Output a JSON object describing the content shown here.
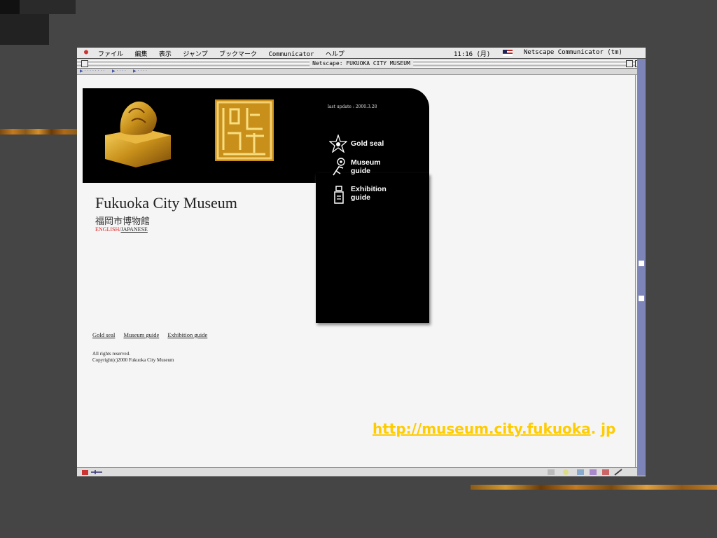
{
  "menubar": {
    "menus": [
      "ファイル",
      "編集",
      "表示",
      "ジャンプ",
      "ブックマーク",
      "Communicator",
      "ヘルプ"
    ],
    "clock": "11:16 (月)",
    "app_name": "Netscape Communicator (tm)"
  },
  "window": {
    "title": "Netscape: FUKUOKA CITY MUSEUM"
  },
  "page": {
    "last_update": "last update : 2000.3.28",
    "nav": [
      {
        "label": "Gold seal",
        "icon": "gold-seal-icon"
      },
      {
        "label": "Museum\nguide",
        "icon": "museum-guide-icon"
      },
      {
        "label": "Exhibition\nguide",
        "icon": "exhibition-guide-icon"
      }
    ],
    "site_title": "Fukuoka City Museum",
    "site_title_jp": "福岡市博物館",
    "lang_english": "ENGLISH",
    "lang_sep": "/",
    "lang_japanese": "JAPANESE",
    "bottom_links": [
      "Gold seal",
      "Museum guide",
      "Exhibition guide"
    ],
    "rights": "All rights reserved.",
    "copyright": "Copyright(c)2000 Fukuoka City Museum"
  },
  "caption": {
    "url_main": "http://museum.city.fukuoka",
    "url_tail": ". jp"
  },
  "colors": {
    "caption": "#ffcc00",
    "english_link": "#e02020"
  }
}
